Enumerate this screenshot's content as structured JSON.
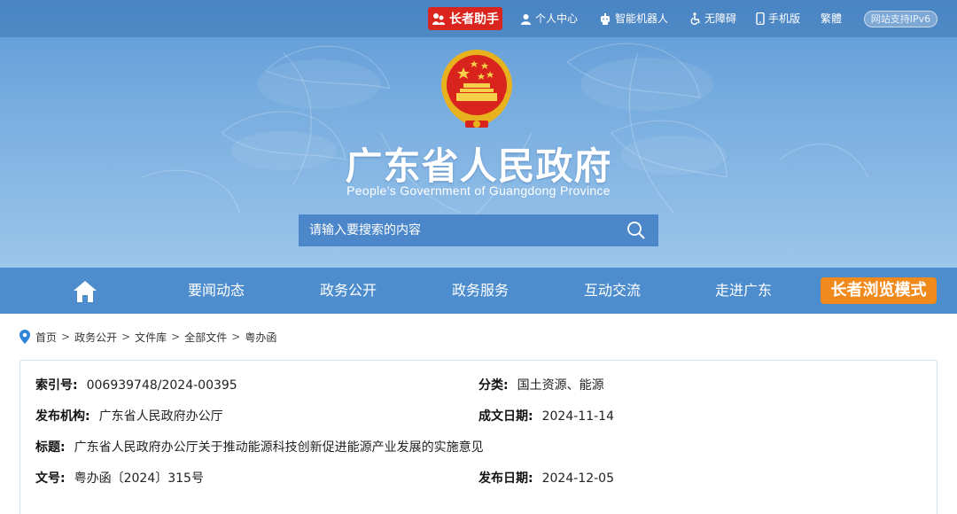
{
  "topbar": {
    "elder_helper": "长者助手",
    "personal_center": "个人中心",
    "robot": "智能机器人",
    "accessibility": "无障碍",
    "mobile": "手机版",
    "traditional": "繁體",
    "ipv6": "网站支持IPv6"
  },
  "site": {
    "title": "广东省人民政府",
    "subtitle": "People’s Government of Guangdong Province"
  },
  "search": {
    "placeholder": "请输入要搜索的内容"
  },
  "nav": {
    "items": [
      "要闻动态",
      "政务公开",
      "政务服务",
      "互动交流",
      "走进广东"
    ],
    "elder_mode": "长者浏览模式"
  },
  "breadcrumb": [
    "首页",
    "政务公开",
    "文件库",
    "全部文件",
    "粤办函"
  ],
  "document": {
    "index_label": "索引号:",
    "index_value": "006939748/2024-00395",
    "category_label": "分类:",
    "category_value": "国土资源、能源",
    "issuer_label": "发布机构:",
    "issuer_value": "广东省人民政府办公厅",
    "written_label": "成文日期:",
    "written_value": "2024-11-14",
    "title_label": "标题:",
    "title_value": "广东省人民政府办公厅关于推动能源科技创新促进能源产业发展的实施意见",
    "docno_label": "文号:",
    "docno_value": "粤办函〔2024〕315号",
    "published_label": "发布日期:",
    "published_value": "2024-12-05"
  },
  "colors": {
    "header_blue": "#6aa3db",
    "nav_blue": "#4d8ccd",
    "elder_red": "#d9251d",
    "elder_orange": "#f08a1c"
  }
}
